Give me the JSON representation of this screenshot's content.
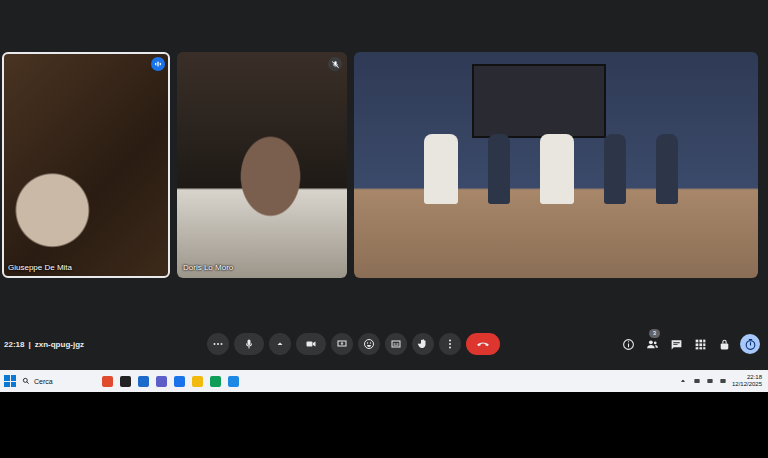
{
  "meeting": {
    "time": "22:18",
    "separator": "|",
    "code": "zxn-qpug-jgz"
  },
  "participants": [
    {
      "name": "Giuseppe De Mita",
      "speaking": true,
      "muted": false,
      "selected": true
    },
    {
      "name": "Doris Lo Moro",
      "speaking": false,
      "muted": true,
      "selected": false
    }
  ],
  "controls": {
    "people_count": "3"
  },
  "taskbar": {
    "search": "Cerca",
    "time": "22:18",
    "date": "12/12/2025"
  }
}
